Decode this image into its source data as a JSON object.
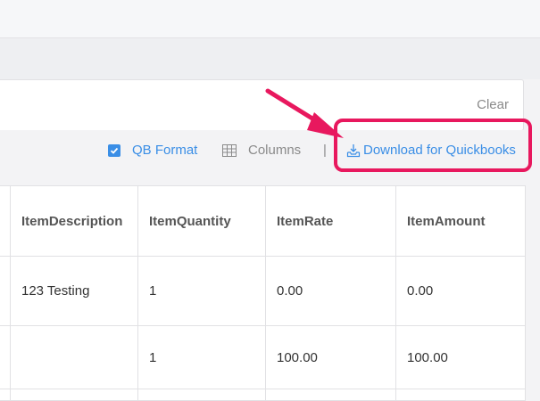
{
  "filter": {
    "clear_label": "Clear"
  },
  "toolbar": {
    "qb_format_label": "QB Format",
    "qb_format_checked": true,
    "qb_format_icon": "checkbox-checked-icon",
    "columns_label": "Columns",
    "columns_icon": "grid-icon",
    "separator": "|",
    "download_label": "Download for Quickbooks",
    "download_icon": "download-icon"
  },
  "colors": {
    "accent": "#3a8ee6",
    "highlight": "#e8185e",
    "muted": "#8a8a8a"
  },
  "table": {
    "headers": [
      "ItemDescription",
      "ItemQuantity",
      "ItemRate",
      "ItemAmount"
    ],
    "rows": [
      [
        "123 Testing",
        "1",
        "0.00",
        "0.00"
      ],
      [
        "",
        "1",
        "100.00",
        "100.00"
      ]
    ]
  }
}
